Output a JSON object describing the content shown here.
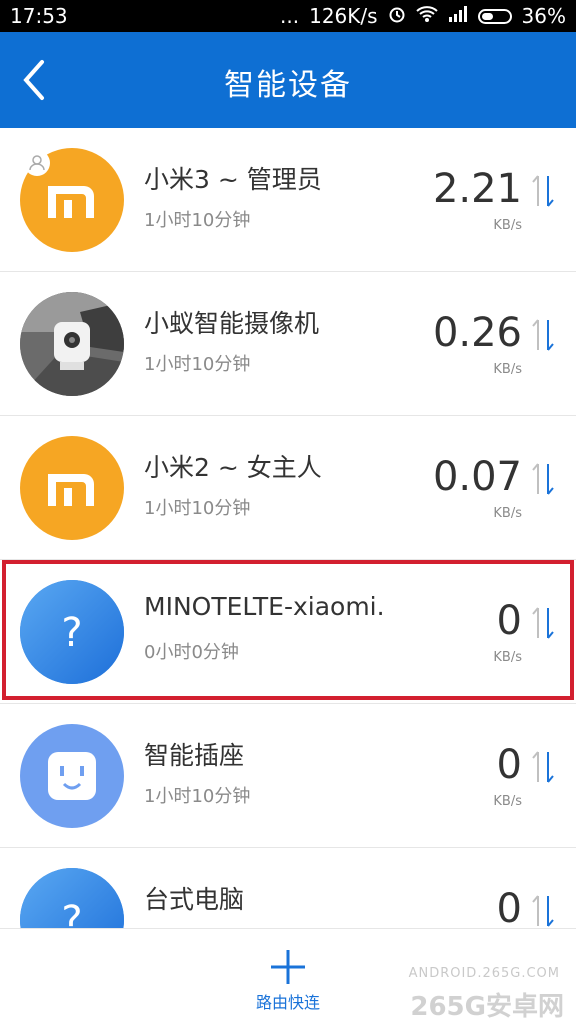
{
  "status": {
    "time": "17:53",
    "dots": "...",
    "net_speed": "126K/s",
    "battery": "36%"
  },
  "header": {
    "title": "智能设备"
  },
  "devices": [
    {
      "name": "小米3 ~ 管理员",
      "time": "1小时10分钟",
      "speed": "2.21",
      "unit": "KB/s",
      "icon": "mi-logo-icon"
    },
    {
      "name": "小蚁智能摄像机",
      "time": "1小时10分钟",
      "speed": "0.26",
      "unit": "KB/s",
      "icon": "camera-photo-icon"
    },
    {
      "name": "小米2 ~ 女主人",
      "time": "1小时10分钟",
      "speed": "0.07",
      "unit": "KB/s",
      "icon": "mi-logo-icon"
    },
    {
      "name": "MINOTELTE-xiaomi.",
      "time": "0小时0分钟",
      "speed": "0",
      "unit": "KB/s",
      "icon": "question-icon"
    },
    {
      "name": "智能插座",
      "time": "1小时10分钟",
      "speed": "0",
      "unit": "KB/s",
      "icon": "smart-plug-icon"
    },
    {
      "name": "台式电脑",
      "time": "",
      "speed": "0",
      "unit": "",
      "icon": "question-icon"
    }
  ],
  "bottom": {
    "label": "路由快连"
  },
  "watermark": {
    "line1": "ANDROID.265G.COM",
    "line2": "265G安卓网"
  },
  "colors": {
    "appbar": "#0e6fd3",
    "accent": "#1a73d9",
    "orange": "#f6a623",
    "highlight": "#d3202f"
  }
}
